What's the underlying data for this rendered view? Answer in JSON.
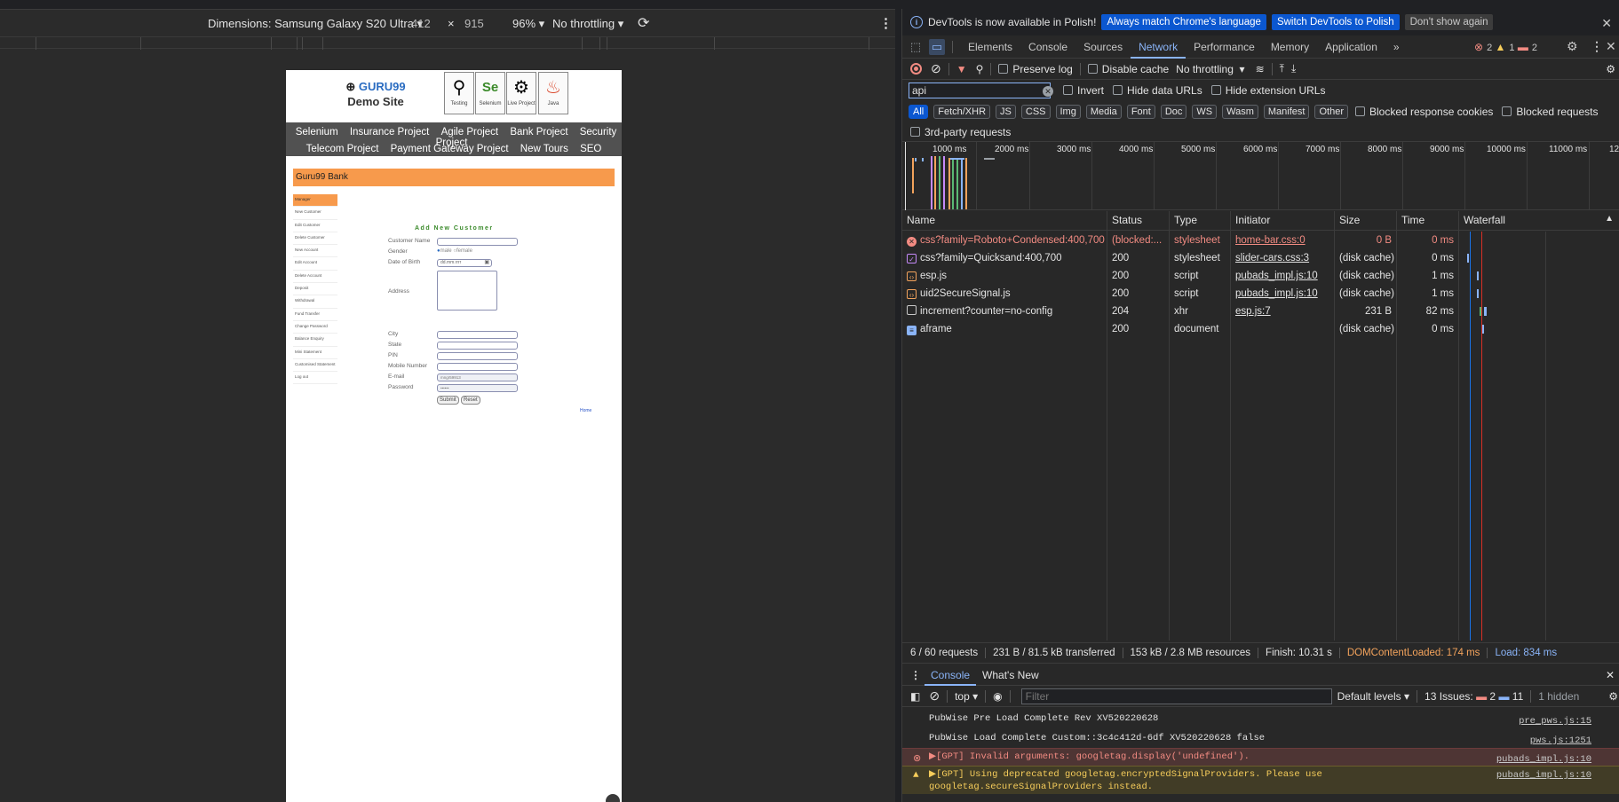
{
  "emulator": {
    "dimensions_label": "Dimensions: Samsung Galaxy S20 Ultra",
    "width": "412",
    "times": "×",
    "height": "915",
    "zoom": "96%",
    "throttle": "No throttling"
  },
  "site": {
    "logo_line1": "GURU99",
    "logo_line2": "Demo Site",
    "icons": [
      {
        "caption": "Testing",
        "icon": "magnifier-icon"
      },
      {
        "caption": "Selenium",
        "icon": "selenium-icon"
      },
      {
        "caption": "Live Project",
        "icon": "gears-icon"
      },
      {
        "caption": "Java",
        "icon": "java-icon"
      }
    ],
    "nav_row1": [
      "Selenium",
      "Insurance Project",
      "Agile Project",
      "Bank Project",
      "Security Project"
    ],
    "nav_row2": [
      "Telecom Project",
      "Payment Gateway Project",
      "New Tours",
      "SEO"
    ],
    "bank_title": "Guru99 Bank",
    "menu": [
      "Manager",
      "New Customer",
      "Edit Customer",
      "Delete Customer",
      "New Account",
      "Edit Account",
      "Delete Account",
      "Deposit",
      "Withdrawal",
      "Fund Transfer",
      "Change Password",
      "Balance Enquiry",
      "Mini Statement",
      "Customised Statement",
      "Log out"
    ],
    "form_title": "Add New Customer",
    "labels": {
      "name": "Customer Name",
      "gender": "Gender",
      "dob": "Date of Birth",
      "address": "Address",
      "city": "City",
      "state": "State",
      "pin": "PIN",
      "mobile": "Mobile Number",
      "email": "E-mail",
      "password": "Password"
    },
    "gender_male": "male",
    "gender_female": "female",
    "dob_placeholder": "dd.mm.rrrr",
    "email_value": "mngr59913",
    "password_value": "••••••",
    "submit": "Submit",
    "reset": "Reset",
    "home": "Home"
  },
  "devtools": {
    "info_message": "DevTools is now available in Polish!",
    "info_btn1": "Always match Chrome's language",
    "info_btn2": "Switch DevTools to Polish",
    "info_btn3": "Don't show again",
    "tabs": [
      "Elements",
      "Console",
      "Sources",
      "Network",
      "Performance",
      "Memory",
      "Application"
    ],
    "more_tabs": "»",
    "errors": "2",
    "warnings": "1",
    "issues": "2",
    "preserve_log": "Preserve log",
    "disable_cache": "Disable cache",
    "throttling": "No throttling",
    "filter_value": "api",
    "invert": "Invert",
    "hide_data_urls": "Hide data URLs",
    "hide_ext_urls": "Hide extension URLs",
    "type_filters": [
      "All",
      "Fetch/XHR",
      "JS",
      "CSS",
      "Img",
      "Media",
      "Font",
      "Doc",
      "WS",
      "Wasm",
      "Manifest",
      "Other"
    ],
    "blocked_cookies": "Blocked response cookies",
    "blocked_requests": "Blocked requests",
    "third_party": "3rd-party requests",
    "timeline_ticks": [
      "1000 ms",
      "2000 ms",
      "3000 ms",
      "4000 ms",
      "5000 ms",
      "6000 ms",
      "7000 ms",
      "8000 ms",
      "9000 ms",
      "10000 ms",
      "11000 ms",
      "12"
    ],
    "columns": [
      "Name",
      "Status",
      "Type",
      "Initiator",
      "Size",
      "Time",
      "Waterfall"
    ],
    "requests": [
      {
        "name": "css?family=Roboto+Condensed:400,700",
        "status": "(blocked:...",
        "type": "stylesheet",
        "initiator": "home-bar.css:0",
        "size": "0 B",
        "time": "0 ms",
        "kind": "error",
        "icon": "error-icon"
      },
      {
        "name": "css?family=Quicksand:400,700",
        "status": "200",
        "type": "stylesheet",
        "initiator": "slider-cars.css:3",
        "size": "(disk cache)",
        "time": "0 ms",
        "kind": "css",
        "icon": "stylesheet-icon"
      },
      {
        "name": "esp.js",
        "status": "200",
        "type": "script",
        "initiator": "pubads_impl.js:10",
        "size": "(disk cache)",
        "time": "1 ms",
        "kind": "js",
        "icon": "script-icon"
      },
      {
        "name": "uid2SecureSignal.js",
        "status": "200",
        "type": "script",
        "initiator": "pubads_impl.js:10",
        "size": "(disk cache)",
        "time": "1 ms",
        "kind": "js",
        "icon": "script-icon"
      },
      {
        "name": "increment?counter=no-config",
        "status": "204",
        "type": "xhr",
        "initiator": "esp.js:7",
        "size": "231 B",
        "time": "82 ms",
        "kind": "xhr",
        "icon": "xhr-icon"
      },
      {
        "name": "aframe",
        "status": "200",
        "type": "document",
        "initiator": "",
        "size": "(disk cache)",
        "time": "0 ms",
        "kind": "doc",
        "icon": "document-icon"
      }
    ],
    "status": {
      "requests": "6 / 60 requests",
      "transferred": "231 B / 81.5 kB transferred",
      "resources": "153 kB / 2.8 MB resources",
      "finish": "Finish: 10.31 s",
      "dcl": "DOMContentLoaded: 174 ms",
      "load": "Load: 834 ms"
    },
    "drawer_tabs": [
      "Console",
      "What's New"
    ],
    "console": {
      "context": "top",
      "filter_placeholder": "Filter",
      "levels": "Default levels",
      "issues_label": "13 Issues:",
      "issues_err": "2",
      "issues_info": "11",
      "hidden": "1 hidden",
      "lines": [
        {
          "text": "PubWise Pre Load Complete Rev XV520220628",
          "src": "pre_pws.js:15",
          "level": "log"
        },
        {
          "text": "PubWise Load Complete Custom::3c4c412d-6df XV520220628 false",
          "src": "pws.js:1251",
          "level": "log"
        },
        {
          "text": "▶[GPT] Invalid arguments: googletag.display('undefined').",
          "src": "pubads_impl.js:10",
          "level": "error"
        },
        {
          "text": "▶[GPT] Using deprecated googletag.encryptedSignalProviders. Please use",
          "text2": "googletag.secureSignalProviders instead.",
          "src": "pubads_impl.js:10",
          "level": "warning"
        }
      ]
    }
  },
  "colors": {
    "accent": "#8ab4f8",
    "primary_button": "#0b57d0",
    "error": "#f28b82",
    "warning": "#f6cd5b",
    "dcl": "#f3a35c",
    "site_orange": "#f79a4c"
  }
}
